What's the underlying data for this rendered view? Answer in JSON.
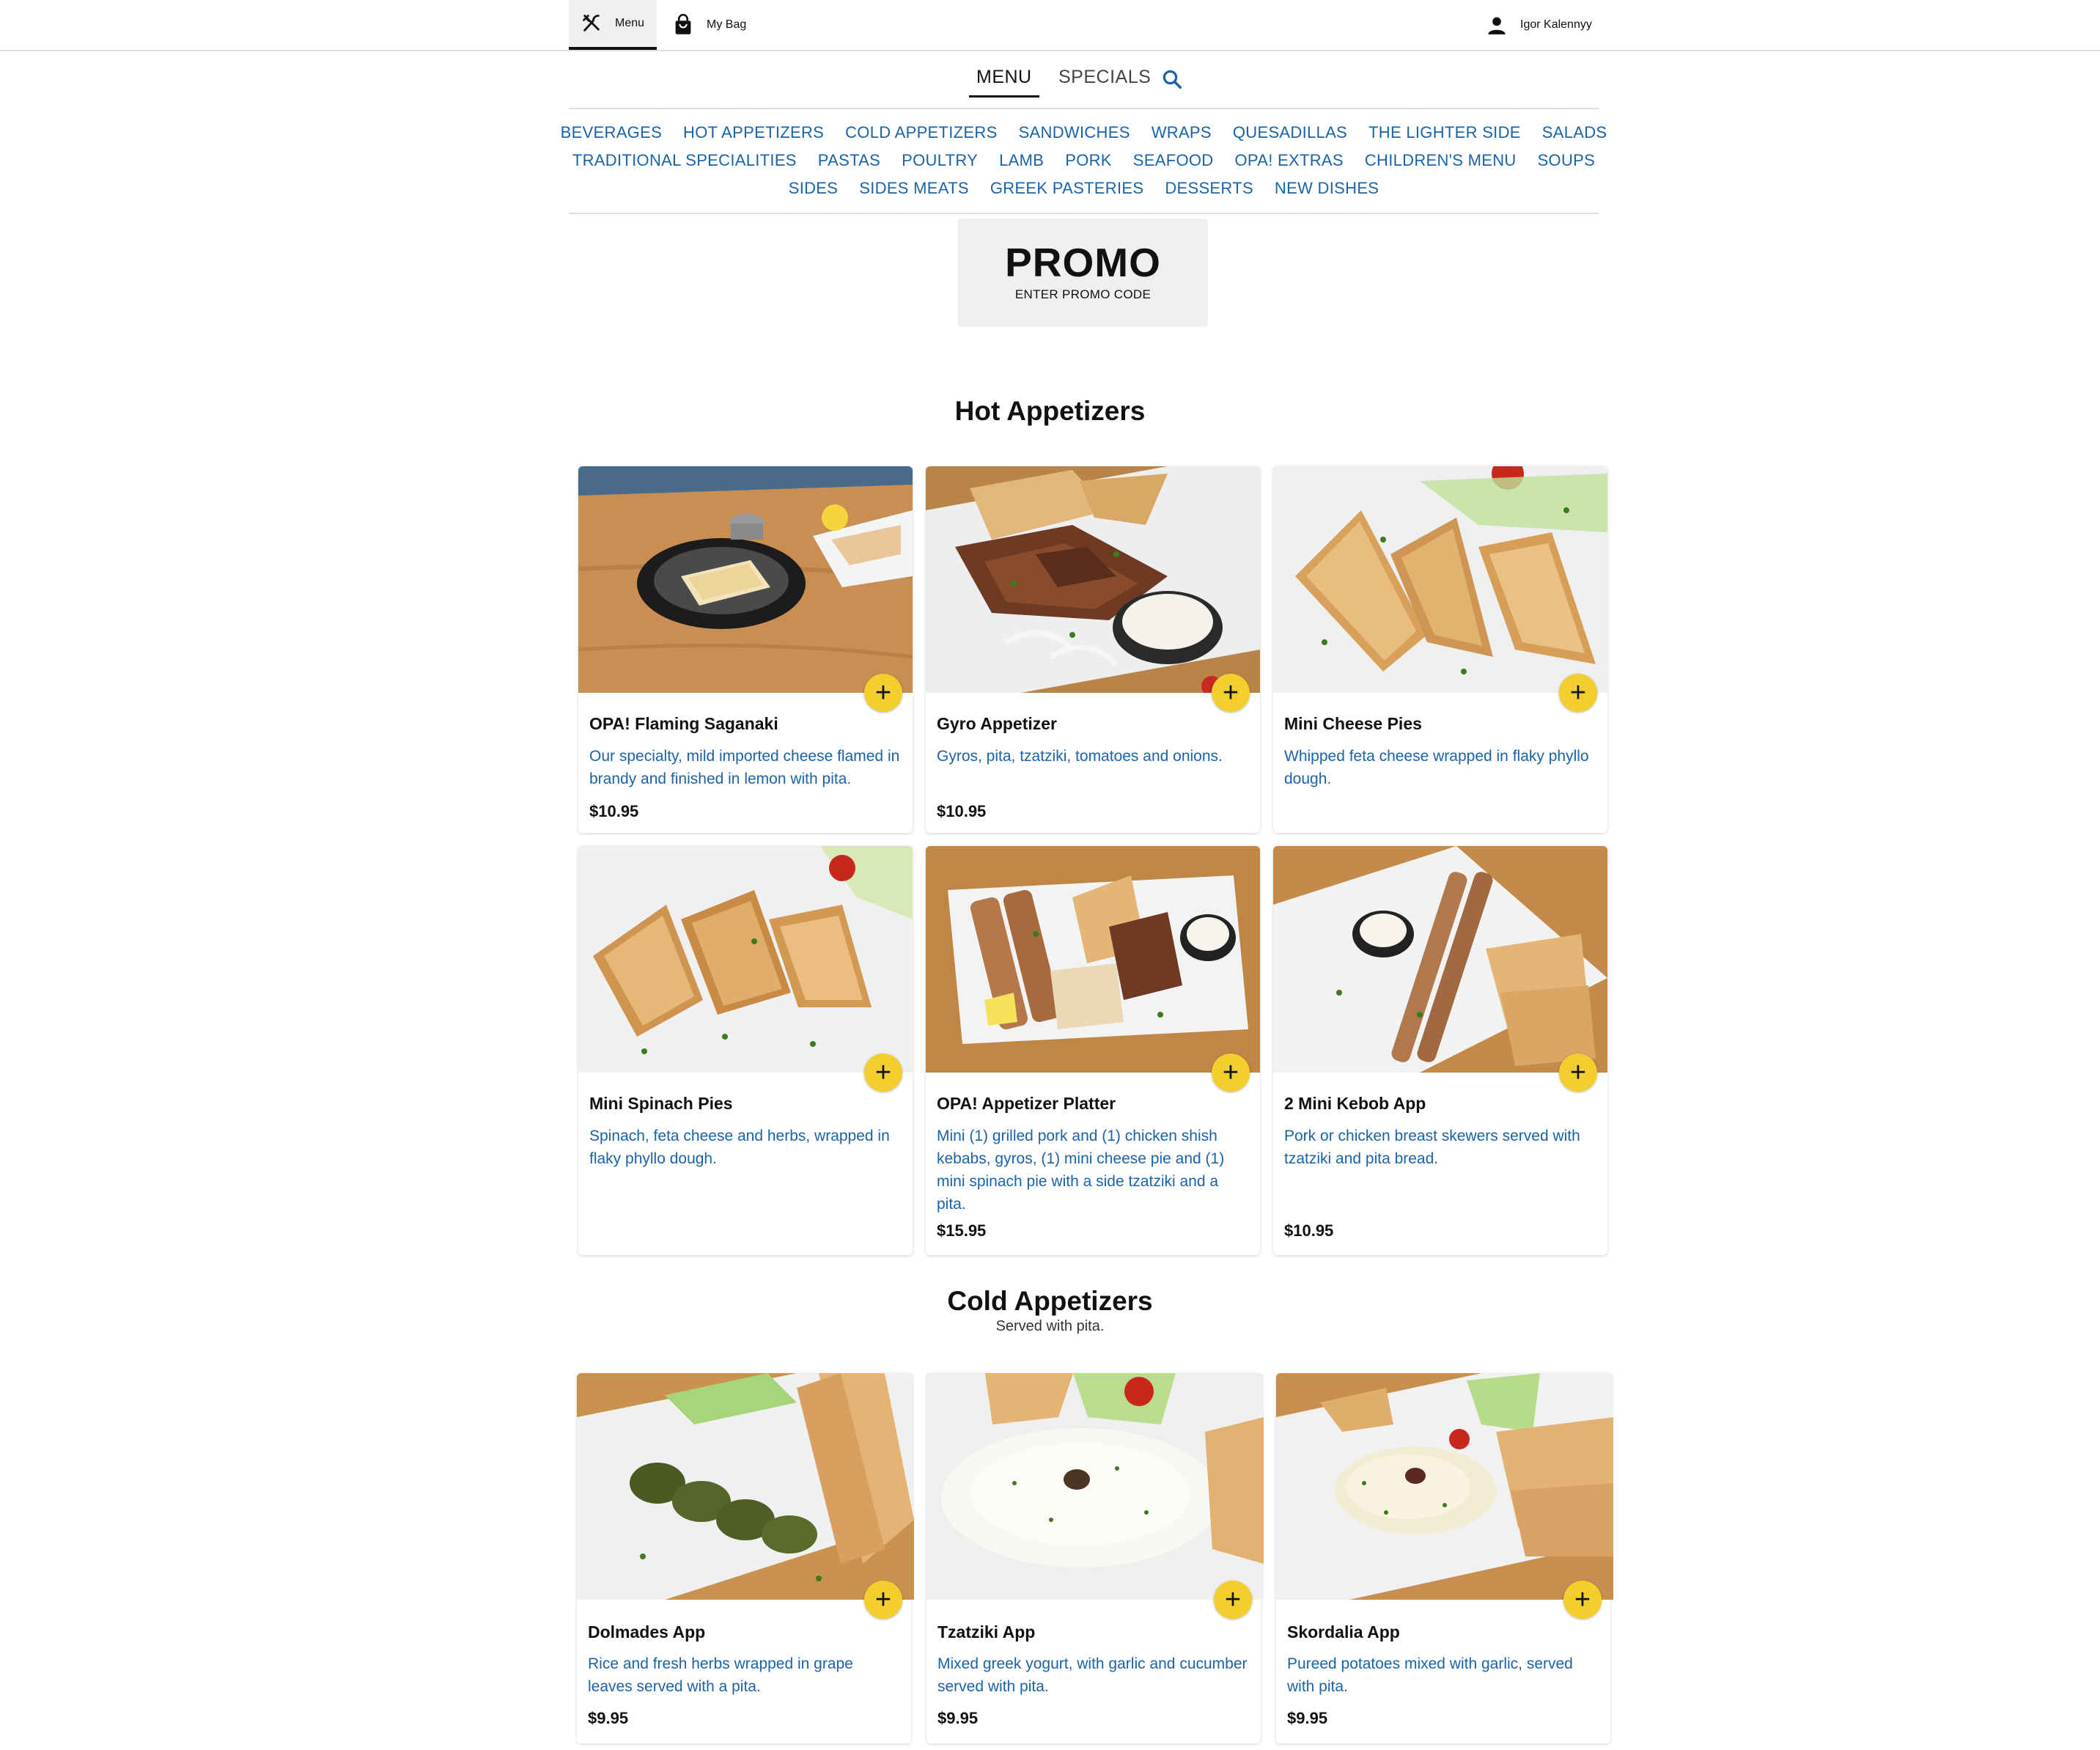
{
  "topbar": {
    "menu_label": "Menu",
    "bag_label": "My Bag",
    "user_name": "Igor Kalennyy"
  },
  "tabs": {
    "menu": "MENU",
    "specials": "SPECIALS"
  },
  "categories": {
    "row1": [
      "BEVERAGES",
      "HOT APPETIZERS",
      "COLD APPETIZERS",
      "SANDWICHES",
      "WRAPS",
      "QUESADILLAS",
      "THE LIGHTER SIDE",
      "SALADS"
    ],
    "row2": [
      "TRADITIONAL SPECIALITIES",
      "PASTAS",
      "POULTRY",
      "LAMB",
      "PORK",
      "SEAFOOD",
      "OPA! EXTRAS",
      "CHILDREN'S MENU",
      "SOUPS"
    ],
    "row3": [
      "SIDES",
      "SIDES MEATS",
      "GREEK PASTERIES",
      "DESSERTS",
      "NEW DISHES"
    ]
  },
  "promo": {
    "title": "PROMO",
    "subtitle": "ENTER PROMO CODE"
  },
  "hot": {
    "title": "Hot Appetizers",
    "items": [
      {
        "name": "OPA! Flaming Saganaki",
        "desc": "Our specialty, mild imported cheese flamed in brandy and finished in lemon with pita.",
        "price": "$10.95"
      },
      {
        "name": "Gyro Appetizer",
        "desc": "Gyros, pita, tzatziki, tomatoes and onions.",
        "price": "$10.95"
      },
      {
        "name": "Mini Cheese Pies",
        "desc": "Whipped feta cheese wrapped in flaky phyllo dough.",
        "price": ""
      },
      {
        "name": "Mini Spinach Pies",
        "desc": "Spinach, feta cheese and herbs, wrapped in flaky phyllo dough.",
        "price": ""
      },
      {
        "name": "OPA! Appetizer Platter",
        "desc": "Mini (1) grilled pork and (1) chicken shish kebabs, gyros, (1) mini cheese pie and (1) mini spinach pie with a side tzatziki and a pita.",
        "price": "$15.95"
      },
      {
        "name": "2 Mini Kebob App",
        "desc": "Pork or chicken breast skewers served with tzatziki and pita bread.",
        "price": "$10.95"
      }
    ]
  },
  "cold": {
    "title": "Cold Appetizers",
    "subtitle": "Served with pita.",
    "items": [
      {
        "name": "Dolmades App",
        "desc": "Rice and fresh herbs wrapped in grape leaves served with a pita.",
        "price": "$9.95"
      },
      {
        "name": "Tzatziki App",
        "desc": "Mixed greek yogurt, with garlic and cucumber served with pita.",
        "price": "$9.95"
      },
      {
        "name": "Skordalia App",
        "desc": "Pureed potatoes mixed with garlic, served with pita.",
        "price": "$9.95"
      }
    ]
  },
  "add_symbol": "+",
  "colors": {
    "accent_link": "#1a63a8",
    "add_button": "#f2cf2f",
    "promo_bg": "#efefef"
  }
}
